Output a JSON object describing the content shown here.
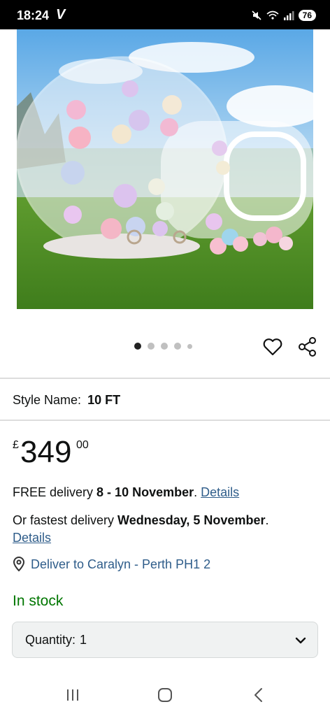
{
  "status_bar": {
    "time": "18:24",
    "carrier_mark": "V",
    "icons": [
      "mute-icon",
      "wifi-icon",
      "signal-icon"
    ],
    "battery": "76"
  },
  "product": {
    "image_description_icon": "product-image",
    "image_dots": {
      "count": 5,
      "active_index": 0
    },
    "style_label": "Style Name:",
    "style_value": "10 FT",
    "price": {
      "currency": "£",
      "whole": "349",
      "fraction": "00"
    },
    "delivery": {
      "free_prefix": "FREE delivery ",
      "free_dates": "8 - 10 November",
      "free_suffix": ". ",
      "free_link": "Details",
      "fast_prefix": "Or fastest delivery ",
      "fast_date": "Wednesday, 5 November",
      "fast_suffix": ".",
      "fast_link": "Details"
    },
    "deliver_to": "Deliver to Caralyn - Perth PH1 2",
    "stock": "In stock",
    "quantity": {
      "label": "Quantity:",
      "value": "1"
    }
  },
  "colors": {
    "link": "#2f5d8a",
    "in_stock": "#007600",
    "quantity_bg": "#f0f2f2"
  }
}
